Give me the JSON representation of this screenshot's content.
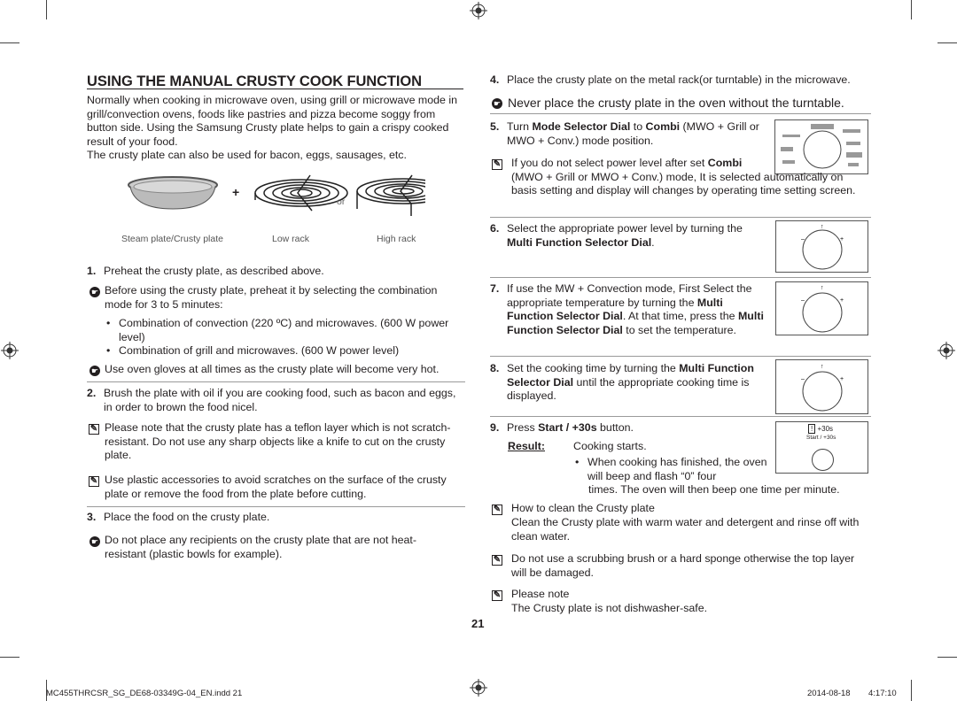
{
  "title": "USING THE MANUAL CRUSTY COOK FUNCTION",
  "intro": [
    "Normally when cooking in microwave oven, using grill or microwave mode in grill/convection ovens, foods like pastries and pizza become soggy from button side. Using the Samsung Crusty plate helps to gain a crispy cooked result of your food.",
    "The crusty plate can also be used for bacon, eggs, sausages, etc."
  ],
  "illustration": {
    "plus": "+",
    "or": "or",
    "captions": [
      "Steam plate/Crusty plate",
      "Low rack",
      "High rack"
    ]
  },
  "left": {
    "s1": {
      "num": "1.",
      "text": "Preheat the crusty plate, as described above."
    },
    "h1": "Before using the crusty plate, preheat it by selecting the combination mode for 3 to 5 minutes:",
    "b1": "Combination of convection (220 ºC) and microwaves. (600 W power level)",
    "b2": "Combination of grill and microwaves. (600 W power level)",
    "h2": "Use oven gloves at all times as the crusty plate will become very hot.",
    "s2": {
      "num": "2.",
      "text": "Brush the plate with oil if you are cooking food, such as bacon and eggs, in order to brown the food nicel."
    },
    "n1": "Please note that the crusty plate has a teflon layer which is not scratch-resistant. Do not use any sharp objects like a knife to cut on the crusty plate.",
    "n2": "Use plastic accessories to avoid scratches on the surface of the crusty plate or remove the food from the plate before cutting.",
    "s3": {
      "num": "3.",
      "text": "Place the food on the crusty plate."
    },
    "h3": "Do not place any recipients on the crusty plate that are not heat-resistant (plastic bowls for example)."
  },
  "right": {
    "s4": {
      "num": "4.",
      "text": "Place the crusty plate on the metal rack(or turntable) in the microwave."
    },
    "h4": "Never place the crusty plate in the oven without the turntable.",
    "s5": {
      "num": "5.",
      "a": "Turn ",
      "b": "Mode Selector Dial",
      "c": " to ",
      "d": "Combi",
      "e": " (MWO + Grill or MWO + Conv.) mode position."
    },
    "n5": {
      "a": "If you do not select power level after set ",
      "b": "Combi",
      "c": " (MWO + Grill or MWO + Conv.) mode, It is selected automatically on basis setting and display will changes by operating time setting screen."
    },
    "s6": {
      "num": "6.",
      "a": "Select the appropriate power level by turning the ",
      "b": "Multi Function Selector Dial",
      "c": "."
    },
    "s7": {
      "num": "7.",
      "a": "If use the MW + Convection mode, First Select the appropriate temperature by turning the ",
      "b": "Multi Function Selector Dial",
      "c": ". At that time, press the ",
      "d": "Multi Function Selector Dial",
      "e": " to set the temperature."
    },
    "s8": {
      "num": "8.",
      "a": "Set the cooking time by turning the ",
      "b": "Multi Function Selector Dial",
      "c": " until the appropriate cooking time is displayed."
    },
    "s9": {
      "num": "9.",
      "a": "Press ",
      "b": "Start / +30s",
      "c": " button."
    },
    "result": {
      "label": "Result:",
      "text": "Cooking starts.",
      "bullet": "When cooking has finished, the oven will beep and flash “0” four",
      "cont": "times. The oven will then beep one time per minute."
    },
    "n6": {
      "head": "How to clean the Crusty plate",
      "text": "Clean the Crusty plate with warm water and detergent and rinse off with clean water."
    },
    "n7": "Do not use a scrubbing brush or a hard sponge otherwise the top layer will be damaged.",
    "n8": {
      "head": "Please note",
      "text": "The Crusty plate is not dishwasher-safe."
    },
    "start_button": {
      "label1": "+30s",
      "label2": "Start / +30s"
    }
  },
  "page_number": "21",
  "footer": {
    "file": "MC455THRCSR_SG_DE68-03349G-04_EN.indd   21",
    "date": "2014-08-18",
    "time": "4:17:10"
  }
}
